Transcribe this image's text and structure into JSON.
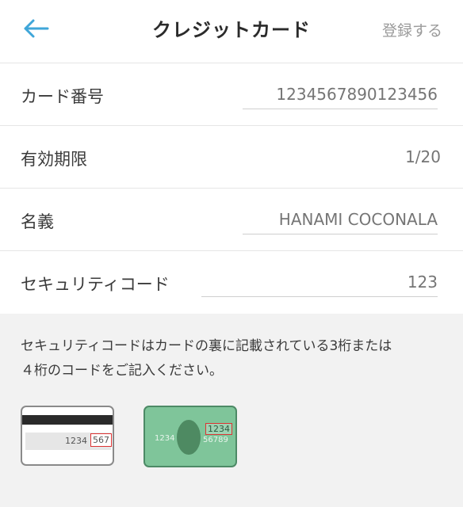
{
  "header": {
    "title": "クレジットカード",
    "submit_label": "登録する",
    "back_icon": "arrow-left-icon",
    "accent_color": "#3fa6d9"
  },
  "form": {
    "card_number": {
      "label": "カード番号",
      "placeholder": "1234567890123456"
    },
    "expiry": {
      "label": "有効期限",
      "value": "1/20"
    },
    "name": {
      "label": "名義",
      "placeholder": "HANAMI COCONALA"
    },
    "security": {
      "label": "セキュリティコード",
      "placeholder": "123"
    }
  },
  "info": {
    "note_line1": "セキュリティコードはカードの裏に記載されている3桁または",
    "note_line2": "４桁のコードをご記入ください。",
    "card_back": {
      "number": "1234",
      "code": "567"
    },
    "card_front": {
      "number_left": "1234",
      "code": "1234",
      "number_right": "56789"
    }
  }
}
